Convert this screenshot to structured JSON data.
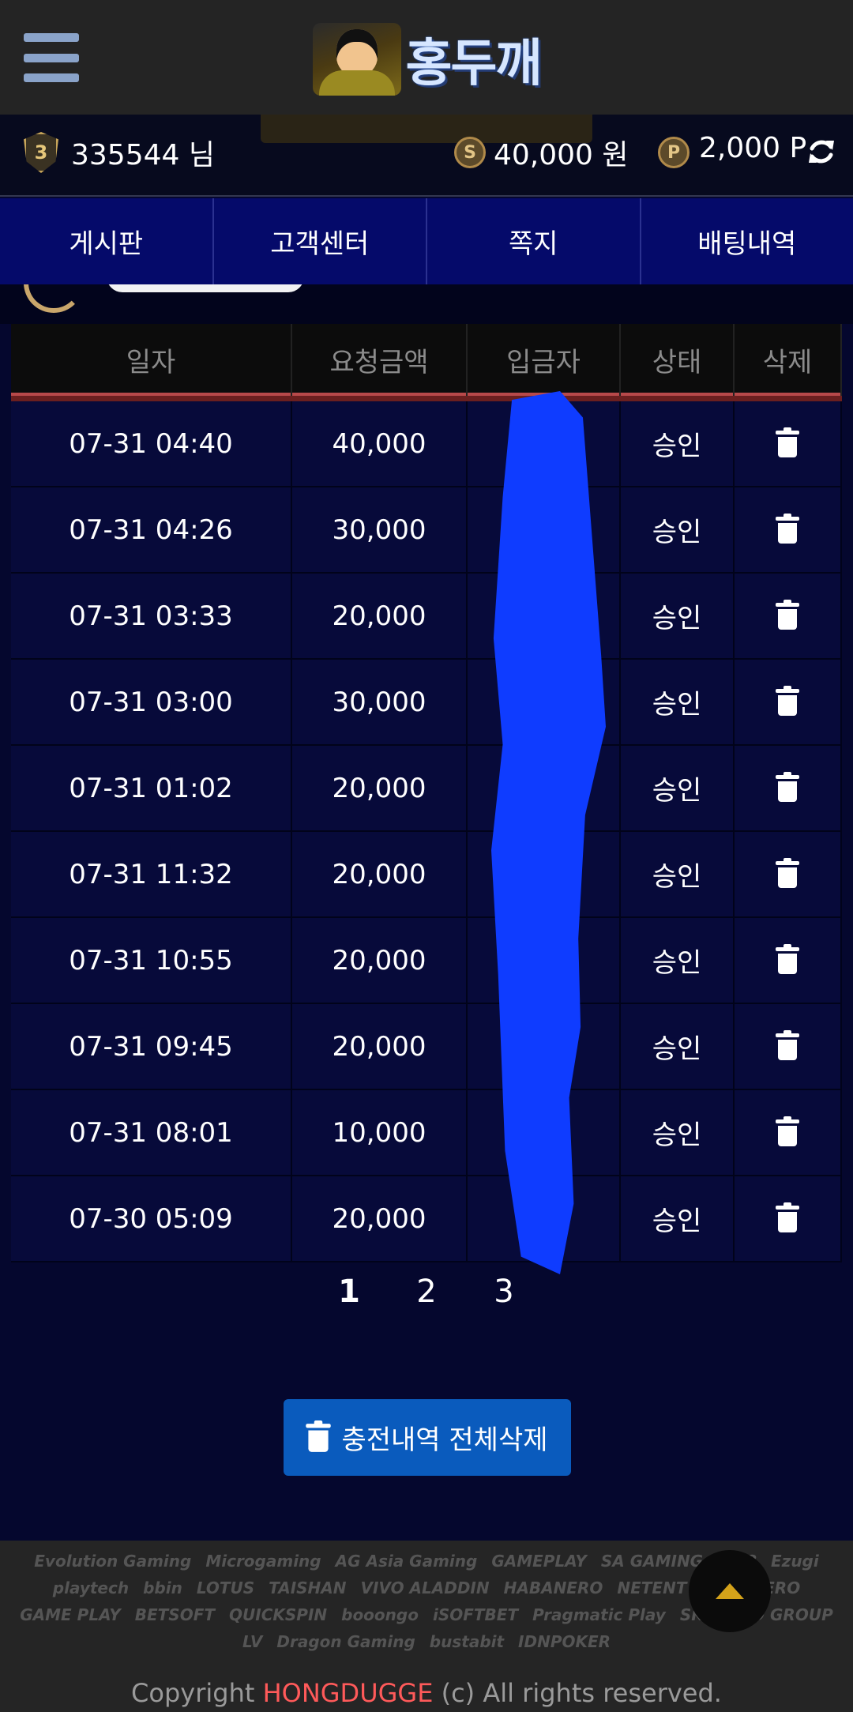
{
  "header": {
    "logo_text": "홍두깨",
    "menu_icon": "hamburger-icon"
  },
  "account": {
    "level": "3",
    "user_id": "335544 님",
    "money": "40,000 원",
    "points": "2,000 P",
    "money_icon": "S",
    "points_icon": "P"
  },
  "nav": {
    "tabs": [
      "게시판",
      "고객센터",
      "쪽지",
      "배팅내역"
    ]
  },
  "table": {
    "headers": [
      "일자",
      "요청금액",
      "입금자",
      "상태",
      "삭제"
    ],
    "rows": [
      {
        "date": "07-31 04:40",
        "amount": "40,000",
        "status": "승인"
      },
      {
        "date": "07-31 04:26",
        "amount": "30,000",
        "status": "승인"
      },
      {
        "date": "07-31 03:33",
        "amount": "20,000",
        "status": "승인"
      },
      {
        "date": "07-31 03:00",
        "amount": "30,000",
        "status": "승인"
      },
      {
        "date": "07-31 01:02",
        "amount": "20,000",
        "status": "승인"
      },
      {
        "date": "07-31 11:32",
        "amount": "20,000",
        "status": "승인"
      },
      {
        "date": "07-31 10:55",
        "amount": "20,000",
        "status": "승인"
      },
      {
        "date": "07-31 09:45",
        "amount": "20,000",
        "status": "승인"
      },
      {
        "date": "07-31 08:01",
        "amount": "10,000",
        "status": "승인"
      },
      {
        "date": "07-30 05:09",
        "amount": "20,000",
        "status": "승인"
      }
    ]
  },
  "pagination": {
    "pages": [
      "1",
      "2",
      "3"
    ],
    "current": "1"
  },
  "actions": {
    "delete_all_label": "충전내역 전체삭제"
  },
  "footer": {
    "providers": [
      "Evolution Gaming",
      "Microgaming",
      "AG Asia Gaming",
      "GAMEPLAY",
      "SA GAMING",
      "W88",
      "Ezugi",
      "playtech",
      "bbin",
      "LOTUS",
      "TAISHAN",
      "VIVO ALADDIN",
      "HABANERO",
      "NETENT",
      "HABANERO",
      "GAME PLAY",
      "BETSOFT",
      "QUICKSPIN",
      "booongo",
      "iSOFTBET",
      "Pragmatic Play",
      "SKYWIND GROUP",
      "LV",
      "Dragon Gaming",
      "bustabit",
      "IDNPOKER"
    ],
    "copyright_prefix": "Copyright ",
    "copyright_brand": "HONGDUGGE",
    "copyright_suffix": " (c) All rights reserved."
  }
}
